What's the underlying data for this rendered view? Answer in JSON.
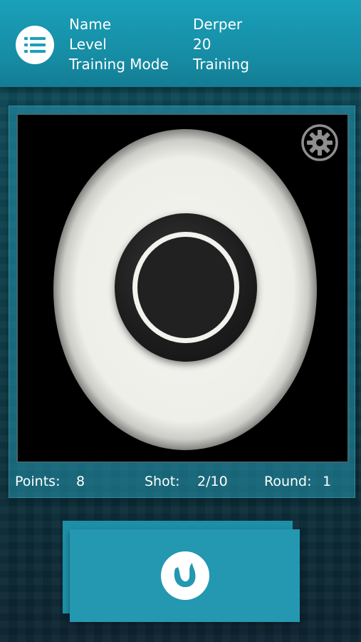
{
  "header": {
    "menu_icon": "list-icon",
    "rows": [
      {
        "label": "Name",
        "value": "Derper"
      },
      {
        "label": "Level",
        "value": "20"
      },
      {
        "label": "Training Mode",
        "value": "Training"
      }
    ]
  },
  "target": {
    "settings_icon": "gear-icon"
  },
  "stats": {
    "points_label": "Points:",
    "points_value": "8",
    "shot_label": "Shot:",
    "shot_value": "2/10",
    "round_label": "Round:",
    "round_value": "1"
  },
  "fire_button": {
    "icon": "flame-swirl-icon"
  },
  "colors": {
    "accent": "#1aa0ba",
    "panel": "#2497b1",
    "background": "#0b3b47"
  }
}
